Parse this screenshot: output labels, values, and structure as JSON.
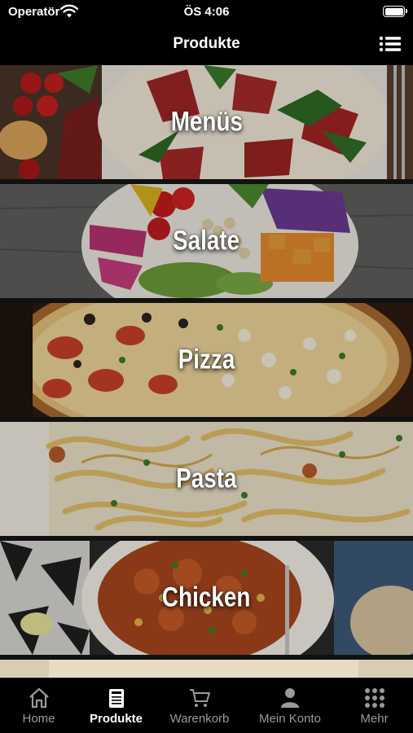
{
  "status_bar": {
    "carrier": "Operatör",
    "time": "ÖS 4:06"
  },
  "nav": {
    "title": "Produkte",
    "menu_icon": "list-icon"
  },
  "categories": [
    {
      "label": "Menüs"
    },
    {
      "label": "Salate"
    },
    {
      "label": "Pizza"
    },
    {
      "label": "Pasta"
    },
    {
      "label": "Chicken"
    }
  ],
  "tabs": [
    {
      "label": "Home",
      "icon": "home-icon",
      "active": false
    },
    {
      "label": "Produkte",
      "icon": "menu-card-icon",
      "active": true
    },
    {
      "label": "Warenkorb",
      "icon": "cart-icon",
      "active": false
    },
    {
      "label": "Mein Konto",
      "icon": "person-icon",
      "active": false
    },
    {
      "label": "Mehr",
      "icon": "grid-icon",
      "active": false
    }
  ],
  "colors": {
    "bar_background": "#000000",
    "active_tab": "#ffffff",
    "inactive_tab": "#9a9a9a"
  }
}
